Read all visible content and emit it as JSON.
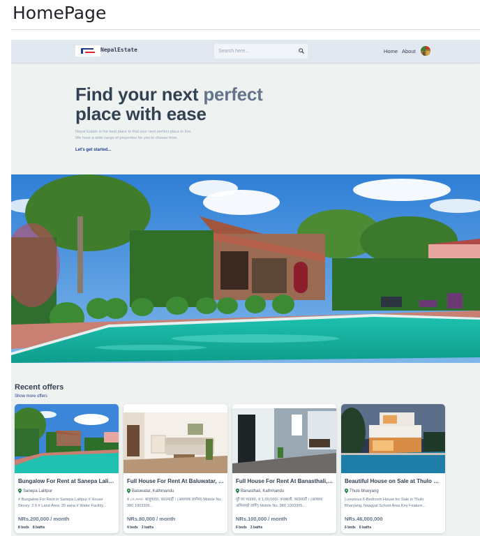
{
  "page_title": "HomePage",
  "header": {
    "brand": "NepalEstate",
    "search_placeholder": "Search here...",
    "nav": {
      "home": "Home",
      "about": "About"
    }
  },
  "hero": {
    "title_line1_a": "Find your next ",
    "title_line1_b": "perfect",
    "title_line2": "place with ease",
    "subtitle_line1": "Nepal Estate is the best place to find your next perfect place to live.",
    "subtitle_line2": "We have a wide range of properties for you to choose from.",
    "cta": "Let's get started..."
  },
  "offers": {
    "title": "Recent offers",
    "link": "Show more offers",
    "cards": [
      {
        "title": "Bungalow For Rent at Sanepa Lalitpur",
        "location": "Sanepa Lalitpur",
        "description": "# Bungalow For Rent in Sanepa Lalitpur # House Storey: 2.5 # Land Area: 20 aana # Water Facility...",
        "price": "NRs.200,000 / month",
        "beds": "8 beds",
        "baths": "8 baths"
      },
      {
        "title": "Full House For Rent At Baluwatar, Kathmandu",
        "location": "Baluwatar, Kathmandu",
        "description": "रु ८०,०००/- बालुवाटार, काठमाडौं । (अवश्यक लागेमा) Mobile No. 980 1003305...",
        "price": "NRs.80,000 / month",
        "beds": "4 beds",
        "baths": "3 baths"
      },
      {
        "title": "Full House For Rent At Banasthali, Kathmandu",
        "location": "Banasthali, Kathmandu",
        "description": "पुरै घर भाडामा, रु 1,00,000/- वनस्थली, काठमाडौं । (आवास/अफिसको लागि) Mobile No. 980 1003305...",
        "price": "NRs.100,000 / month",
        "beds": "6 beds",
        "baths": "3 baths"
      },
      {
        "title": "Beautiful House on Sale at Thulo bharyang",
        "location": "Thulo bharyang",
        "description": "Luxurious 6-Bedroom House for Sale in Thulo Bharyang, Naagyal School Area Key Feature...",
        "price": "NRs.46,000,000",
        "beds": "6 beds",
        "baths": "6 baths"
      }
    ]
  },
  "colors": {
    "header_bg": "#e2e8f0",
    "page_bg": "#eef3f1",
    "title_text": "#334155",
    "accent_text": "#64748b",
    "link": "#1e3a8a"
  }
}
